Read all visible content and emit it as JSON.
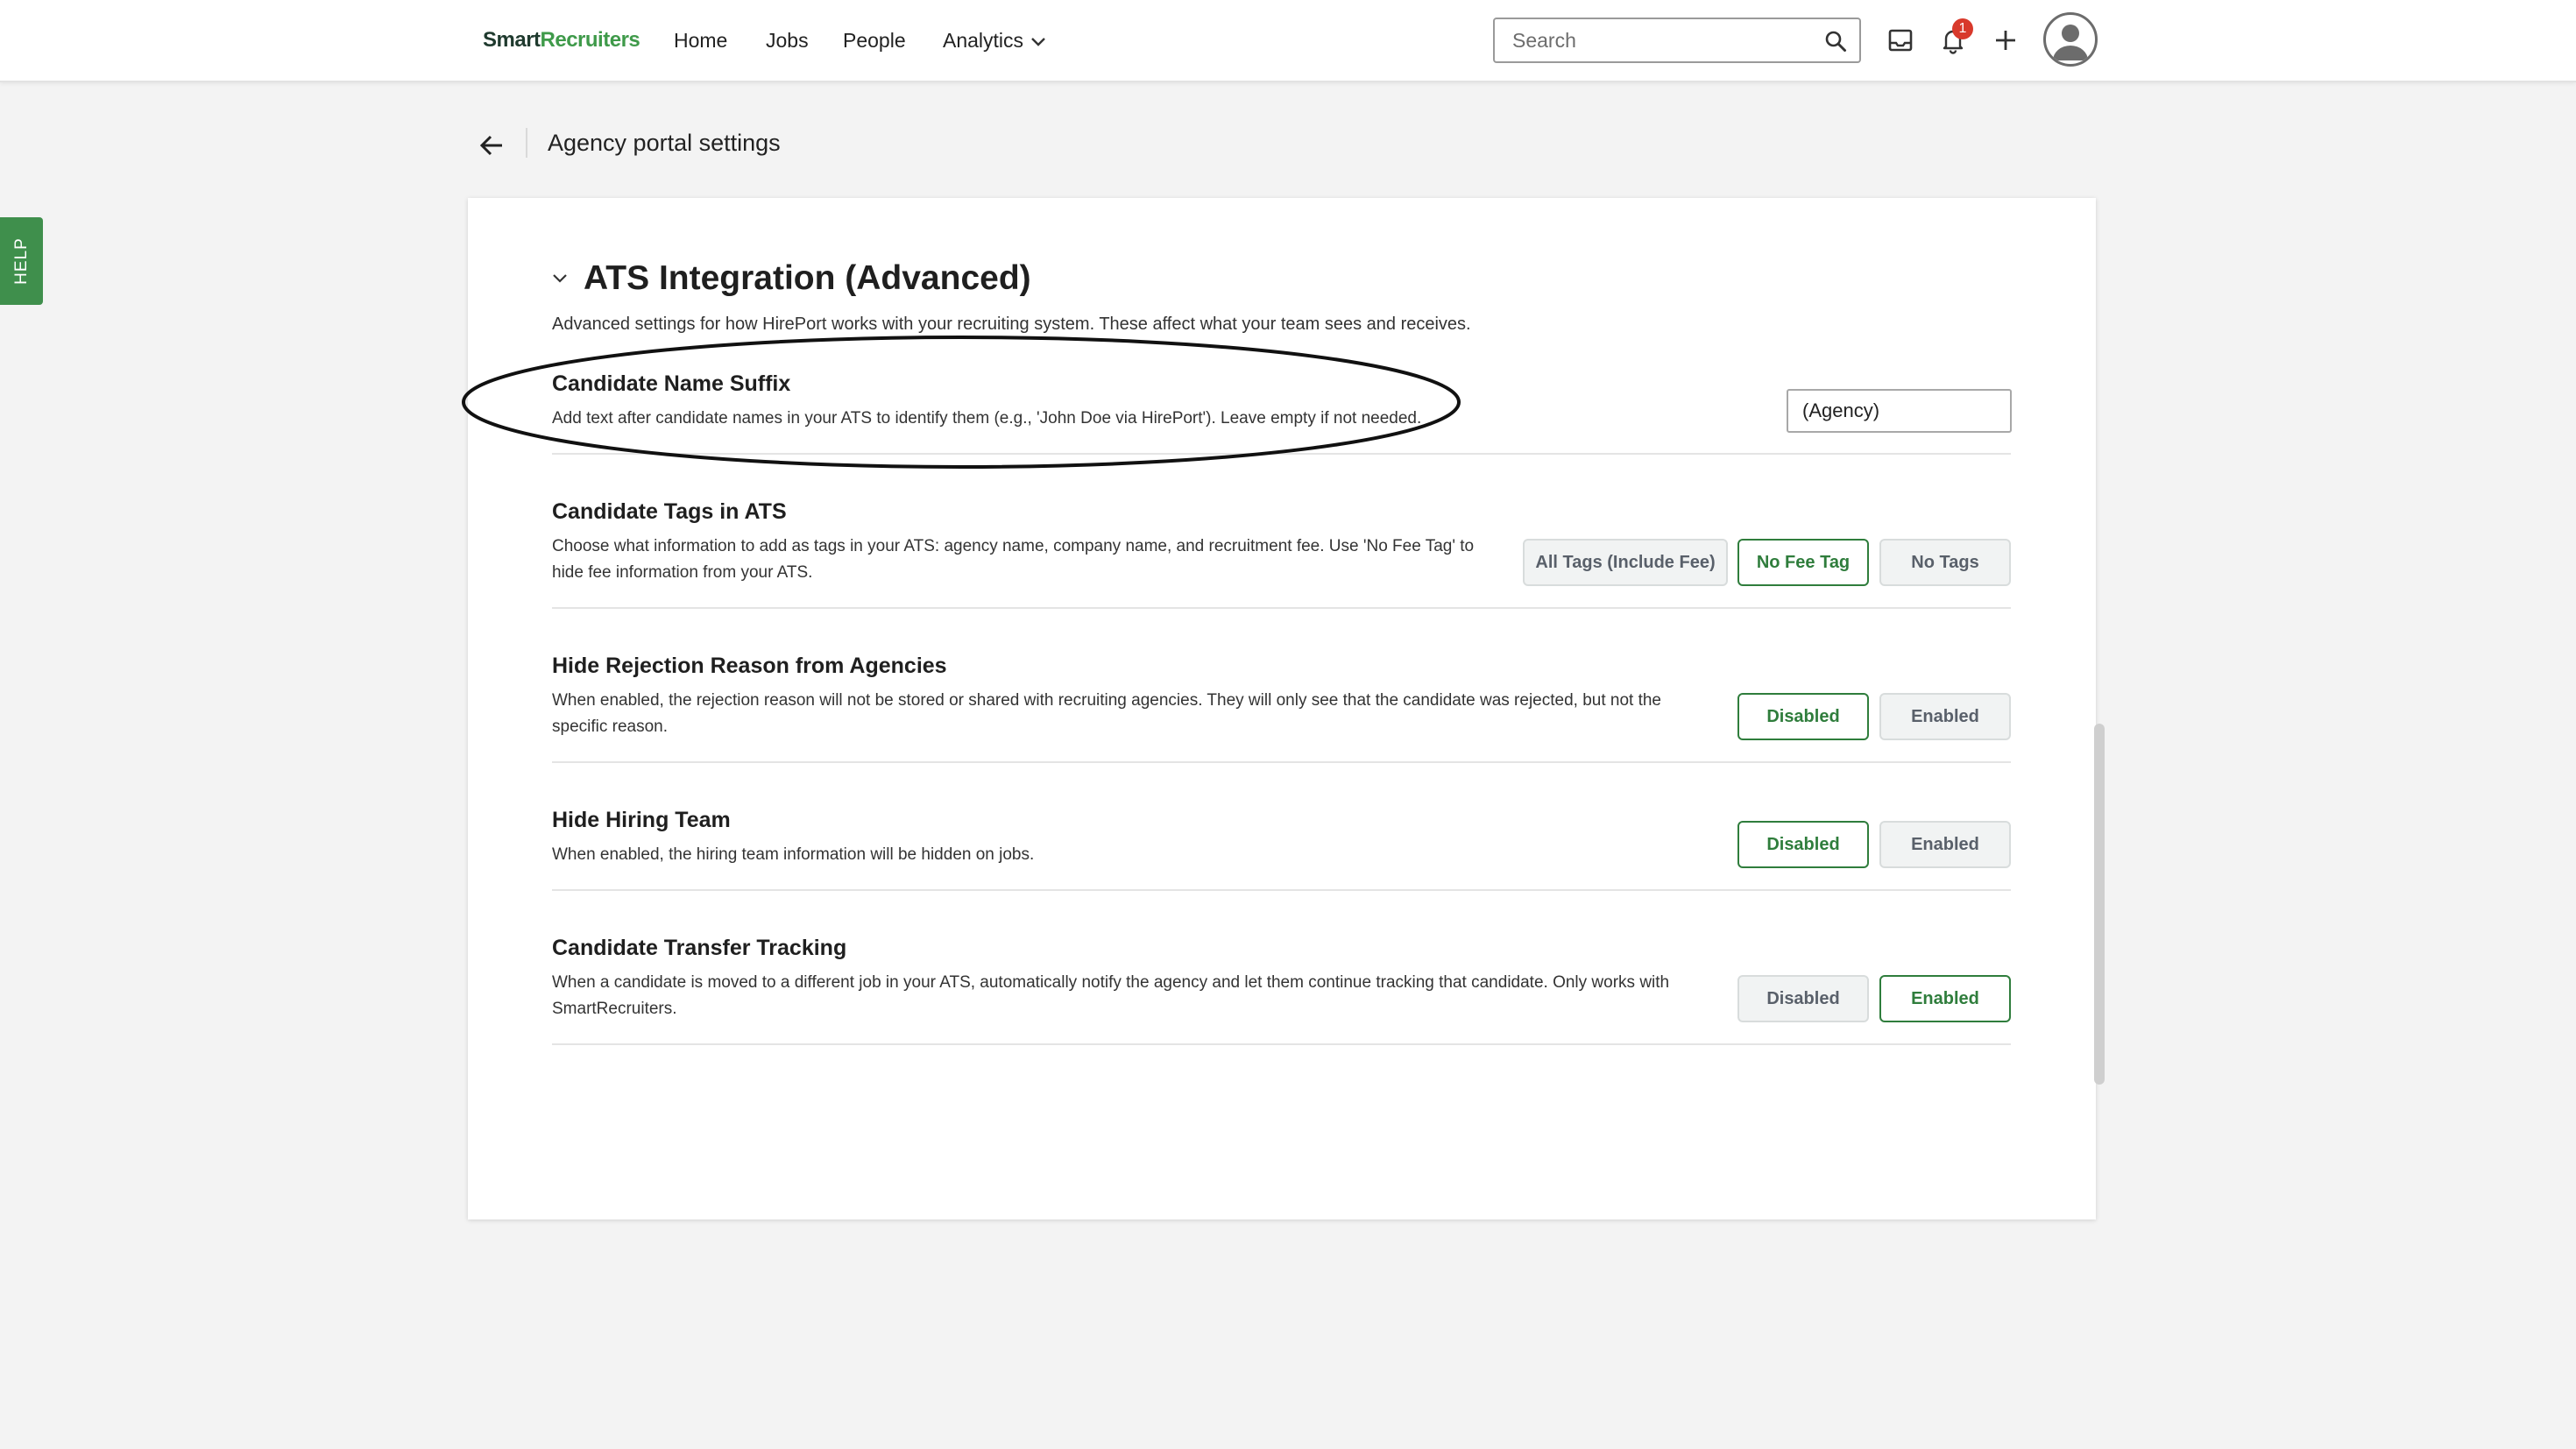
{
  "brand": {
    "part1": "Smart",
    "part2": "Recruiters"
  },
  "nav": {
    "items": [
      {
        "label": "Home"
      },
      {
        "label": "Jobs"
      },
      {
        "label": "People"
      },
      {
        "label": "Analytics"
      }
    ]
  },
  "search": {
    "placeholder": "Search"
  },
  "notifications": {
    "count": "1"
  },
  "help": {
    "label": "HELP"
  },
  "page": {
    "title": "Agency portal settings"
  },
  "section": {
    "title": "ATS Integration (Advanced)",
    "description": "Advanced settings for how HirePort works with your recruiting system. These affect what your team sees and receives."
  },
  "settings": {
    "suffix": {
      "title": "Candidate Name Suffix",
      "description": "Add text after candidate names in your ATS to identify them (e.g., 'John Doe via HirePort'). Leave empty if not needed.",
      "value": "(Agency)"
    },
    "tags": {
      "title": "Candidate Tags in ATS",
      "description_line1": "Choose what information to add as tags in your ATS: agency name, company name, and recruitment fee. Use 'No Fee Tag' to",
      "description_line2": "hide fee information from your ATS.",
      "options": [
        "All Tags (Include Fee)",
        "No Fee Tag",
        "No Tags"
      ],
      "selected": "No Fee Tag"
    },
    "rejection": {
      "title": "Hide Rejection Reason from Agencies",
      "description_line1": "When enabled, the rejection reason will not be stored or shared with recruiting agencies. They will only see that the candidate was rejected, but not the",
      "description_line2": "specific reason.",
      "options": [
        "Disabled",
        "Enabled"
      ],
      "selected": "Disabled"
    },
    "hiring_team": {
      "title": "Hide Hiring Team",
      "description": "When enabled, the hiring team information will be hidden on jobs.",
      "options": [
        "Disabled",
        "Enabled"
      ],
      "selected": "Disabled"
    },
    "transfer": {
      "title": "Candidate Transfer Tracking",
      "description_line1": "When a candidate is moved to a different job in your ATS, automatically notify the agency and let them continue tracking that candidate. Only works with",
      "description_line2": "SmartRecruiters.",
      "options": [
        "Disabled",
        "Enabled"
      ],
      "selected": "Enabled"
    }
  },
  "colors": {
    "brand_green": "#3f9a4a",
    "selected_green": "#2f7d3c",
    "badge_red": "#d8392b",
    "help_green": "#3f8f4c"
  },
  "icons": [
    "search-icon",
    "inbox-icon",
    "bell-icon",
    "plus-icon",
    "avatar-icon",
    "back-arrow-icon",
    "chevron-down-icon"
  ]
}
